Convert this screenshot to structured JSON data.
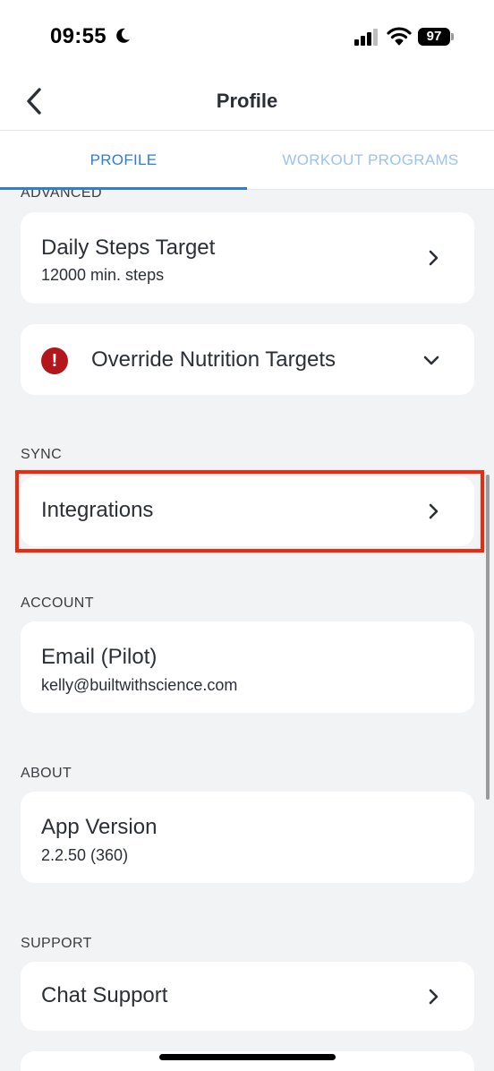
{
  "status_bar": {
    "time": "09:55",
    "battery": "97",
    "icons": [
      "moon-icon",
      "signal-icon",
      "wifi-icon",
      "battery-icon"
    ]
  },
  "nav": {
    "title": "Profile",
    "back_icon": "chevron-left-icon"
  },
  "tabs": [
    {
      "label": "PROFILE",
      "active": true
    },
    {
      "label": "WORKOUT PROGRAMS",
      "active": false
    }
  ],
  "colors": {
    "accent": "#2a7de1",
    "accent_light": "#9cc3f0",
    "alert": "#b3161b",
    "highlight": "#f2270c"
  },
  "sections": {
    "advanced": {
      "label": "ADVANCED",
      "daily_steps": {
        "title": "Daily Steps Target",
        "subtitle": "12000 min. steps"
      },
      "nutrition": {
        "title": "Override Nutrition Targets",
        "icon": "alert-circle-icon"
      }
    },
    "sync": {
      "label": "SYNC",
      "integrations": {
        "title": "Integrations"
      }
    },
    "account": {
      "label": "ACCOUNT",
      "email": {
        "title": "Email (Pilot)",
        "subtitle": "kelly@builtwithscience.com"
      }
    },
    "about": {
      "label": "ABOUT",
      "version": {
        "title": "App Version",
        "subtitle": "2.2.50 (360)"
      }
    },
    "support": {
      "label": "SUPPORT",
      "chat": {
        "title": "Chat Support"
      }
    }
  }
}
